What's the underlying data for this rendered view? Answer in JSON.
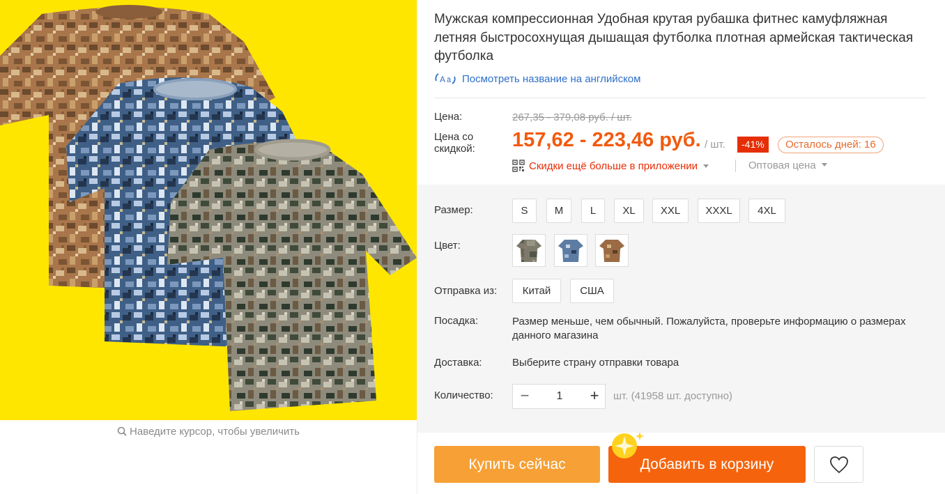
{
  "gallery": {
    "zoom_hint": "Наведите курсор, чтобы увеличить",
    "background_color": "#ffe600"
  },
  "product": {
    "title": "Мужская компрессионная Удобная крутая рубашка фитнес камуфляжная летняя быстросохнущая дышащая футболка плотная армейская тактическая футболка",
    "translate_link": "Посмотреть название на английском"
  },
  "price": {
    "label": "Цена:",
    "old_price": "267,35 - 379,08 руб. / шт.",
    "discount_label": "Цена со скидкой:",
    "new_price": "157,62 - 223,46 руб.",
    "unit": "/ шт.",
    "discount_badge": "-41%",
    "days_left": "Осталось дней: 16",
    "app_promo": "Скидки ещё больше в приложении",
    "wholesale": "Оптовая цена",
    "accent_color": "#f25a0e"
  },
  "options": {
    "size_label": "Размер:",
    "sizes": [
      "S",
      "M",
      "L",
      "XL",
      "XXL",
      "XXXL",
      "4XL"
    ],
    "color_label": "Цвет:",
    "colors": [
      "green-camo",
      "blue-camo",
      "brown-camo"
    ],
    "ship_from_label": "Отправка из:",
    "ship_from": [
      "Китай",
      "США"
    ],
    "fit_label": "Посадка:",
    "fit_note": "Размер меньше, чем обычный. Пожалуйста, проверьте информацию о размерах данного магазина",
    "delivery_label": "Доставка:",
    "delivery_note": "Выберите страну отправки товара",
    "qty_label": "Количество:",
    "qty_value": "1",
    "qty_minus": "−",
    "qty_plus": "+",
    "stock": "шт. (41958 шт. доступно)"
  },
  "actions": {
    "buy_now": "Купить сейчас",
    "add_to_cart": "Добавить в корзину"
  }
}
